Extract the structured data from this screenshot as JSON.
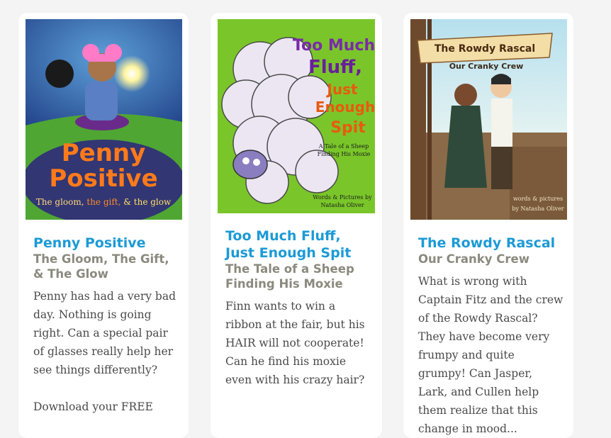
{
  "books": [
    {
      "title": "Penny Positive",
      "subtitle": "The Gloom, The Gift, & The Glow",
      "description": "Penny has had a very bad day. Nothing is going right. Can a special pair of glasses really help her see things differently?",
      "extra": "Download your FREE",
      "cover": {
        "title_line1": "Penny",
        "title_line2": "Positive",
        "tagline_a": "The gloom, ",
        "tagline_b": "the gift, ",
        "tagline_c": "& the glow"
      }
    },
    {
      "title": "Too Much Fluff, Just Enough Spit",
      "subtitle": "The Tale of a Sheep Finding His Moxie",
      "description": "Finn wants to win a ribbon at the fair, but his HAIR will not cooperate! Can he find his moxie even with his crazy hair?",
      "cover": {
        "line1": "Too Much",
        "line2": "Fluff,",
        "line3": "Just",
        "line4": "Enough",
        "line5": "Spit",
        "tag1": "A Tale of a Sheep",
        "tag2": "Finding His Moxie",
        "credit1": "Words & Pictures by",
        "credit2": "Natasha Oliver"
      }
    },
    {
      "title": "The Rowdy Rascal",
      "subtitle": "Our Cranky Crew",
      "description": "What is wrong with Captain Fitz and the crew of the Rowdy Rascal? They have become very frumpy and quite grumpy! Can Jasper, Lark, and Cullen help them realize that this change in mood...",
      "cover": {
        "banner": "The Rowdy Rascal",
        "subbanner": "Our Cranky Crew",
        "credit1": "words & pictures",
        "credit2": "by Natasha Oliver"
      }
    }
  ],
  "colors": {
    "title": "#1c9ad6",
    "subtitle": "#8a8a7e",
    "body": "#4a4a4a"
  }
}
